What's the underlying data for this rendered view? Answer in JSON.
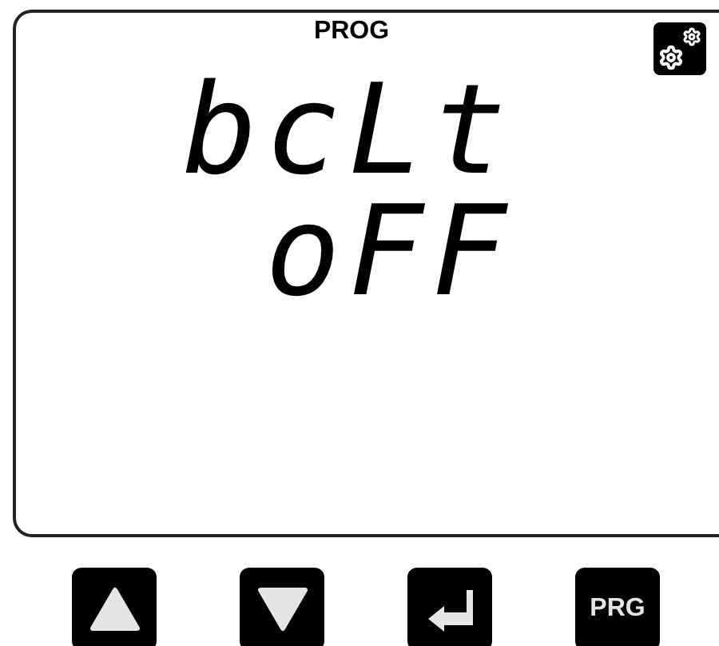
{
  "display": {
    "mode": "PROG",
    "lines": [
      "bcLt",
      "oFF"
    ]
  },
  "buttons": [
    {
      "kind": "up"
    },
    {
      "kind": "down"
    },
    {
      "kind": "enter"
    },
    {
      "kind": "text",
      "label": "PRG"
    }
  ]
}
